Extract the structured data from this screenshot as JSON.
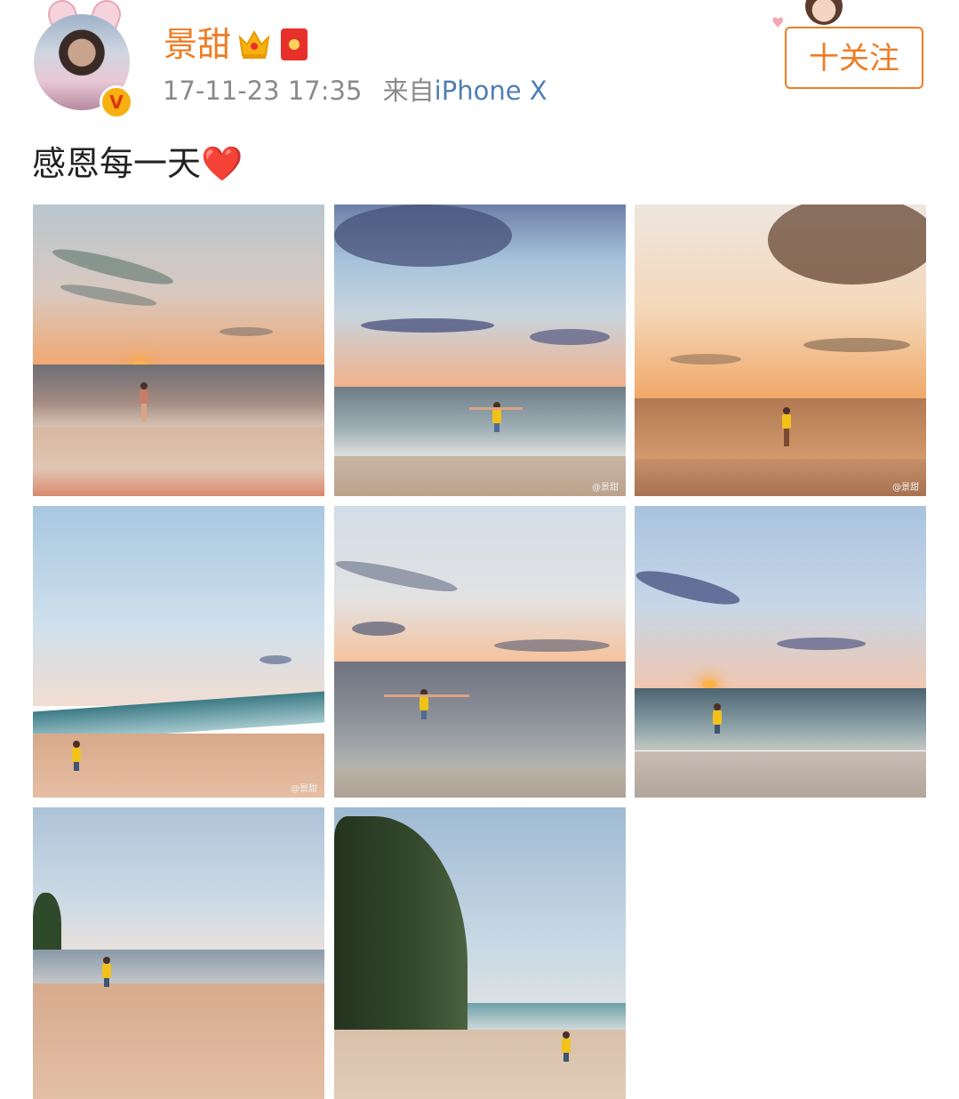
{
  "user": {
    "name": "景甜",
    "timestamp": "17-11-23 17:35",
    "source_prefix": "来自",
    "source_device": "iPhone X",
    "verified_badge": "V"
  },
  "follow_button": {
    "label": "十关注"
  },
  "post": {
    "text": "感恩每一天",
    "emoji": "❤️"
  },
  "photos": [
    {
      "watermark": ""
    },
    {
      "watermark": "@景甜"
    },
    {
      "watermark": "@景甜"
    },
    {
      "watermark": "@景甜"
    },
    {
      "watermark": ""
    },
    {
      "watermark": ""
    },
    {
      "watermark": ""
    },
    {
      "watermark": ""
    }
  ],
  "colors": {
    "accent": "#f07c23",
    "link": "#4f7fb3",
    "meta": "#8a8a8a"
  }
}
